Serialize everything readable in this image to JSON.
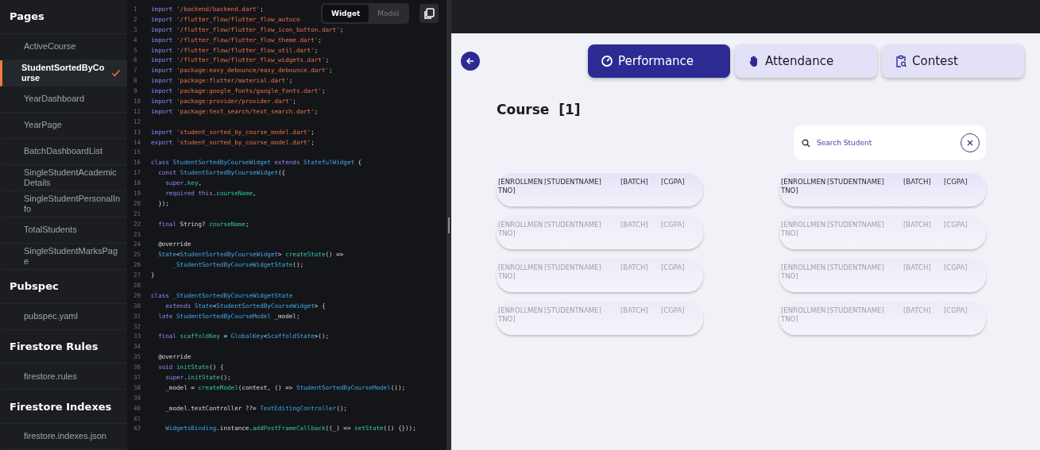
{
  "sidebar": {
    "sections": [
      {
        "title": "Pages",
        "items": [
          {
            "label": "ActiveCourse",
            "selected": false
          },
          {
            "label": "StudentSortedByCourse",
            "selected": true
          },
          {
            "label": "YearDashboard",
            "selected": false
          },
          {
            "label": "YearPage",
            "selected": false
          },
          {
            "label": "BatchDashboardList",
            "selected": false
          },
          {
            "label": "SingleStudentAcademicDetails",
            "selected": false
          },
          {
            "label": "SingleStudentPersonalInfo",
            "selected": false
          },
          {
            "label": "TotalStudents",
            "selected": false
          },
          {
            "label": "SingleStudentMarksPage",
            "selected": false
          }
        ]
      },
      {
        "title": "Pubspec",
        "items": [
          {
            "label": "pubspec.yaml",
            "selected": false
          }
        ]
      },
      {
        "title": "Firestore Rules",
        "items": [
          {
            "label": "firestore.rules",
            "selected": false
          }
        ]
      },
      {
        "title": "Firestore Indexes",
        "items": [
          {
            "label": "firestore.indexes.json",
            "selected": false
          }
        ]
      }
    ]
  },
  "code": {
    "toggle": [
      {
        "label": "Widget",
        "selected": true
      },
      {
        "label": "Model",
        "selected": false
      }
    ],
    "lines": [
      {
        "n": "1",
        "t": [
          {
            "kind": "kw",
            "text": "import "
          },
          {
            "kind": "str",
            "text": "'/backend/backend.dart'"
          },
          {
            "kind": "p",
            "text": ";"
          }
        ]
      },
      {
        "n": "2",
        "t": [
          {
            "kind": "kw",
            "text": "import "
          },
          {
            "kind": "str",
            "text": "'/flutter_flow/flutter_flow_autoco"
          }
        ]
      },
      {
        "n": "3",
        "t": [
          {
            "kind": "kw",
            "text": "import "
          },
          {
            "kind": "str",
            "text": "'/flutter_flow/flutter_flow_icon_button.dart'"
          },
          {
            "kind": "p",
            "text": ";"
          }
        ]
      },
      {
        "n": "4",
        "t": [
          {
            "kind": "kw",
            "text": "import "
          },
          {
            "kind": "str",
            "text": "'/flutter_flow/flutter_flow_theme.dart'"
          },
          {
            "kind": "p",
            "text": ";"
          }
        ]
      },
      {
        "n": "5",
        "t": [
          {
            "kind": "kw",
            "text": "import "
          },
          {
            "kind": "str",
            "text": "'/flutter_flow/flutter_flow_util.dart'"
          },
          {
            "kind": "p",
            "text": ";"
          }
        ]
      },
      {
        "n": "6",
        "t": [
          {
            "kind": "kw",
            "text": "import "
          },
          {
            "kind": "str",
            "text": "'/flutter_flow/flutter_flow_widgets.dart'"
          },
          {
            "kind": "p",
            "text": ";"
          }
        ]
      },
      {
        "n": "7",
        "t": [
          {
            "kind": "kw",
            "text": "import "
          },
          {
            "kind": "str",
            "text": "'package:easy_debounce/easy_debounce.dart'"
          },
          {
            "kind": "p",
            "text": ";"
          }
        ]
      },
      {
        "n": "8",
        "t": [
          {
            "kind": "kw",
            "text": "import "
          },
          {
            "kind": "str",
            "text": "'package:flutter/material.dart'"
          },
          {
            "kind": "p",
            "text": ";"
          }
        ]
      },
      {
        "n": "9",
        "t": [
          {
            "kind": "kw",
            "text": "import "
          },
          {
            "kind": "str",
            "text": "'package:google_fonts/google_fonts.dart'"
          },
          {
            "kind": "p",
            "text": ";"
          }
        ]
      },
      {
        "n": "10",
        "t": [
          {
            "kind": "kw",
            "text": "import "
          },
          {
            "kind": "str",
            "text": "'package:provider/provider.dart'"
          },
          {
            "kind": "p",
            "text": ";"
          }
        ]
      },
      {
        "n": "11",
        "t": [
          {
            "kind": "kw",
            "text": "import "
          },
          {
            "kind": "str",
            "text": "'package:text_search/text_search.dart'"
          },
          {
            "kind": "p",
            "text": ";"
          }
        ]
      },
      {
        "n": "12"
      },
      {
        "n": "13",
        "t": [
          {
            "kind": "kw",
            "text": "import "
          },
          {
            "kind": "str",
            "text": "'student_sorted_by_course_model.dart'"
          },
          {
            "kind": "p",
            "text": ";"
          }
        ]
      },
      {
        "n": "14",
        "t": [
          {
            "kind": "kw",
            "text": "export "
          },
          {
            "kind": "str",
            "text": "'student_sorted_by_course_model.dart'"
          },
          {
            "kind": "p",
            "text": ";"
          }
        ]
      },
      {
        "n": "15"
      },
      {
        "n": "16",
        "t": [
          {
            "kind": "kw",
            "text": "class "
          },
          {
            "kind": "ty",
            "text": "StudentSortedByCourseWidget "
          },
          {
            "kind": "kw",
            "text": "extends "
          },
          {
            "kind": "ty",
            "text": "StatefulWidget "
          },
          {
            "kind": "p",
            "text": "{"
          }
        ]
      },
      {
        "n": "17",
        "t": [
          {
            "kind": "kw",
            "text": "  const "
          },
          {
            "kind": "ty",
            "text": "StudentSortedByCourseWidget"
          },
          {
            "kind": "p",
            "text": "({"
          }
        ]
      },
      {
        "n": "18",
        "t": [
          {
            "kind": "kw",
            "text": "    super"
          },
          {
            "kind": "p",
            "text": "."
          },
          {
            "kind": "pr",
            "text": "key"
          },
          {
            "kind": "p",
            "text": ","
          }
        ]
      },
      {
        "n": "19",
        "t": [
          {
            "kind": "kw",
            "text": "    required this"
          },
          {
            "kind": "p",
            "text": "."
          },
          {
            "kind": "pr",
            "text": "courseName"
          },
          {
            "kind": "p",
            "text": ","
          }
        ]
      },
      {
        "n": "20",
        "t": [
          {
            "kind": "p",
            "text": "  });"
          }
        ]
      },
      {
        "n": "21"
      },
      {
        "n": "22",
        "t": [
          {
            "kind": "kw",
            "text": "  final "
          },
          {
            "kind": "p",
            "text": "String? "
          },
          {
            "kind": "pr",
            "text": "courseName"
          },
          {
            "kind": "p",
            "text": ";"
          }
        ]
      },
      {
        "n": "23"
      },
      {
        "n": "24",
        "t": [
          {
            "kind": "p",
            "text": "  @override"
          }
        ]
      },
      {
        "n": "25",
        "t": [
          {
            "kind": "ty",
            "text": "  State"
          },
          {
            "kind": "p",
            "text": "<"
          },
          {
            "kind": "ty",
            "text": "StudentSortedByCourseWidget"
          },
          {
            "kind": "p",
            "text": "> "
          },
          {
            "kind": "pr",
            "text": "createState"
          },
          {
            "kind": "p",
            "text": "() =>"
          }
        ]
      },
      {
        "n": "26",
        "t": [
          {
            "kind": "ty",
            "text": "      _StudentSortedByCourseWidgetState"
          },
          {
            "kind": "p",
            "text": "();"
          }
        ]
      },
      {
        "n": "27",
        "t": [
          {
            "kind": "p",
            "text": "}"
          }
        ]
      },
      {
        "n": "28"
      },
      {
        "n": "29",
        "t": [
          {
            "kind": "kw",
            "text": "class "
          },
          {
            "kind": "ty",
            "text": "_StudentSortedByCourseWidgetState"
          }
        ]
      },
      {
        "n": "30",
        "t": [
          {
            "kind": "kw",
            "text": "    extends "
          },
          {
            "kind": "ty",
            "text": "State"
          },
          {
            "kind": "p",
            "text": "<"
          },
          {
            "kind": "ty",
            "text": "StudentSortedByCourseWidget"
          },
          {
            "kind": "p",
            "text": "> {"
          }
        ]
      },
      {
        "n": "31",
        "t": [
          {
            "kind": "kw",
            "text": "  late "
          },
          {
            "kind": "ty",
            "text": "StudentSortedByCourseModel "
          },
          {
            "kind": "p",
            "text": "_model;"
          }
        ]
      },
      {
        "n": "32"
      },
      {
        "n": "33",
        "t": [
          {
            "kind": "kw",
            "text": "  final "
          },
          {
            "kind": "pr",
            "text": "scaffoldKey "
          },
          {
            "kind": "p",
            "text": "= "
          },
          {
            "kind": "ty",
            "text": "GlobalKey"
          },
          {
            "kind": "p",
            "text": "<"
          },
          {
            "kind": "ty",
            "text": "ScaffoldState"
          },
          {
            "kind": "p",
            "text": ">();"
          }
        ]
      },
      {
        "n": "34"
      },
      {
        "n": "35",
        "t": [
          {
            "kind": "p",
            "text": "  @override"
          }
        ]
      },
      {
        "n": "36",
        "t": [
          {
            "kind": "kw",
            "text": "  void "
          },
          {
            "kind": "pr",
            "text": "initState"
          },
          {
            "kind": "p",
            "text": "() {"
          }
        ]
      },
      {
        "n": "37",
        "t": [
          {
            "kind": "kw",
            "text": "    super"
          },
          {
            "kind": "p",
            "text": "."
          },
          {
            "kind": "pr",
            "text": "initState"
          },
          {
            "kind": "p",
            "text": "();"
          }
        ]
      },
      {
        "n": "38",
        "t": [
          {
            "kind": "p",
            "text": "    _model = "
          },
          {
            "kind": "pr",
            "text": "createModel"
          },
          {
            "kind": "p",
            "text": "(context, () => "
          },
          {
            "kind": "ty",
            "text": "StudentSortedByCourseModel"
          },
          {
            "kind": "p",
            "text": "());"
          }
        ]
      },
      {
        "n": "39"
      },
      {
        "n": "40",
        "t": [
          {
            "kind": "p",
            "text": "    _model.textController ??= "
          },
          {
            "kind": "ty",
            "text": "TextEditingController"
          },
          {
            "kind": "p",
            "text": "();"
          }
        ]
      },
      {
        "n": "41"
      },
      {
        "n": "42",
        "t": [
          {
            "kind": "ty",
            "text": "    WidgetsBinding"
          },
          {
            "kind": "p",
            "text": ".instance."
          },
          {
            "kind": "pr",
            "text": "addPostFrameCallback"
          },
          {
            "kind": "p",
            "text": "((_) => "
          },
          {
            "kind": "pr",
            "text": "setState"
          },
          {
            "kind": "p",
            "text": "(() {}));"
          }
        ]
      }
    ]
  },
  "preview": {
    "tabs": [
      {
        "label": "Performance",
        "selected": true
      },
      {
        "label": "Attendance",
        "selected": false
      },
      {
        "label": "Contest",
        "selected": false
      }
    ],
    "heading": "Course  [1]",
    "search": {
      "placeholder": "Search Student"
    },
    "columns": [
      {
        "rows": [
          {
            "enrollment": "[ENROLLMENTNO]",
            "name": "[STUDENTNAME]",
            "batch": "[BATCH]",
            "cgpa": "[CGPA]",
            "dimmed": false
          },
          {
            "enrollment": "[ENROLLMENTNO]",
            "name": "[STUDENTNAME]",
            "batch": "[BATCH]",
            "cgpa": "[CGPA]",
            "dimmed": true
          },
          {
            "enrollment": "[ENROLLMENTNO]",
            "name": "[STUDENTNAME]",
            "batch": "[BATCH]",
            "cgpa": "[CGPA]",
            "dimmed": true
          },
          {
            "enrollment": "[ENROLLMENTNO]",
            "name": "[STUDENTNAME]",
            "batch": "[BATCH]",
            "cgpa": "[CGPA]",
            "dimmed": true
          }
        ]
      },
      {
        "rows": [
          {
            "enrollment": "[ENROLLMENTNO]",
            "name": "[STUDENTNAME]",
            "batch": "[BATCH]",
            "cgpa": "[CGPA]",
            "dimmed": false
          },
          {
            "enrollment": "[ENROLLMENTNO]",
            "name": "[STUDENTNAME]",
            "batch": "[BATCH]",
            "cgpa": "[CGPA]",
            "dimmed": true
          },
          {
            "enrollment": "[ENROLLMENTNO]",
            "name": "[STUDENTNAME]",
            "batch": "[BATCH]",
            "cgpa": "[CGPA]",
            "dimmed": true
          },
          {
            "enrollment": "[ENROLLMENTNO]",
            "name": "[STUDENTNAME]",
            "batch": "[BATCH]",
            "cgpa": "[CGPA]",
            "dimmed": true
          }
        ]
      }
    ]
  }
}
